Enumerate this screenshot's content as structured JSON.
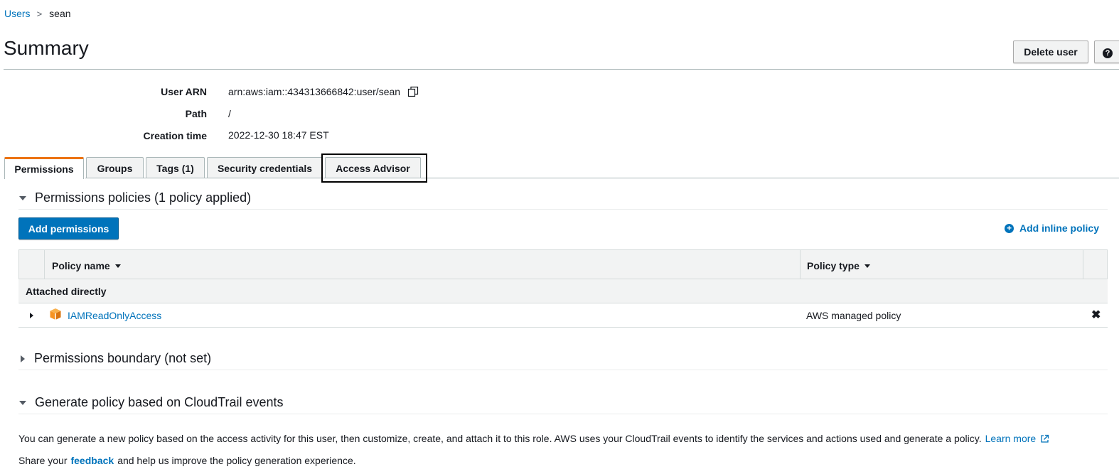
{
  "breadcrumb": {
    "parent": "Users",
    "separator": ">",
    "current": "sean"
  },
  "header": {
    "title": "Summary",
    "delete_label": "Delete user",
    "help_label": "?"
  },
  "summary": {
    "fields": [
      {
        "label": "User ARN",
        "value": "arn:aws:iam::434313666842:user/sean"
      },
      {
        "label": "Path",
        "value": "/"
      },
      {
        "label": "Creation time",
        "value": "2022-12-30 18:47 EST"
      }
    ]
  },
  "tabs": [
    {
      "label": "Permissions",
      "active": true
    },
    {
      "label": "Groups"
    },
    {
      "label": "Tags (1)"
    },
    {
      "label": "Security credentials"
    },
    {
      "label": "Access Advisor",
      "highlighted": true
    }
  ],
  "permissions": {
    "heading": "Permissions policies (1 policy applied)",
    "add_button": "Add permissions",
    "add_inline": "Add inline policy",
    "table": {
      "columns": [
        "Policy name",
        "Policy type"
      ],
      "group_label": "Attached directly",
      "rows": [
        {
          "name": "IAMReadOnlyAccess",
          "type": "AWS managed policy",
          "remove": "✖"
        }
      ]
    }
  },
  "boundary": {
    "heading": "Permissions boundary (not set)"
  },
  "generate": {
    "heading": "Generate policy based on CloudTrail events",
    "text": "You can generate a new policy based on the access activity for this user, then customize, create, and attach it to this role. AWS uses your CloudTrail events to identify the services and actions used and generate a policy.",
    "learn_more": "Learn more",
    "share_prefix": "Share your",
    "feedback": "feedback",
    "share_suffix": "and help us improve the policy generation experience."
  },
  "colors": {
    "link": "#0073bb",
    "primary": "#0073bb",
    "tab_accent": "#ec7211",
    "icon_orange": "#f79321"
  }
}
